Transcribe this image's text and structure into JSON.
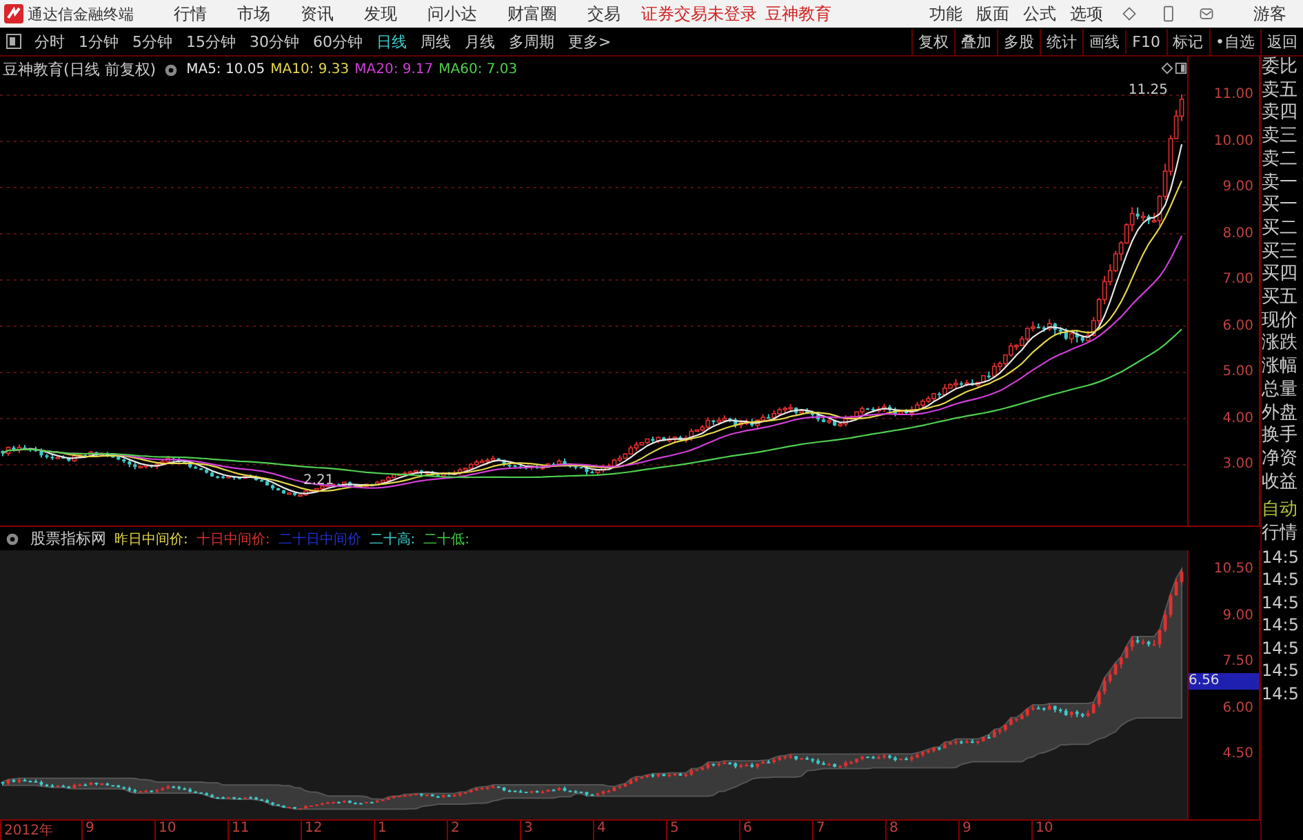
{
  "menu_bar": {
    "app_title": "通达信金融终端",
    "items": [
      "行情",
      "市场",
      "资讯",
      "发现",
      "问小达",
      "财富圈",
      "交易"
    ],
    "notices": [
      "证券交易未登录",
      "豆神教育"
    ],
    "right_items": [
      "功能",
      "版面",
      "公式",
      "选项"
    ],
    "user": "游客"
  },
  "toolbar": {
    "periods": [
      {
        "label": "分时",
        "selected": false
      },
      {
        "label": "1分钟",
        "selected": false
      },
      {
        "label": "5分钟",
        "selected": false
      },
      {
        "label": "15分钟",
        "selected": false
      },
      {
        "label": "30分钟",
        "selected": false
      },
      {
        "label": "60分钟",
        "selected": false
      },
      {
        "label": "日线",
        "selected": true
      },
      {
        "label": "周线",
        "selected": false
      },
      {
        "label": "月线",
        "selected": false
      },
      {
        "label": "多周期",
        "selected": false
      },
      {
        "label": "更多>",
        "selected": false
      }
    ],
    "actions": [
      "复权",
      "叠加",
      "多股",
      "统计",
      "画线",
      "F10",
      "标记",
      "•自选",
      "返回"
    ]
  },
  "price_chart": {
    "title": "豆神教育(日线 前复权)",
    "moving_averages": [
      {
        "label": "MA5: 10.05",
        "color": "#e8e8e8"
      },
      {
        "label": "MA10: 9.33",
        "color": "#e6d84a"
      },
      {
        "label": "MA20: 9.17",
        "color": "#d040d8"
      },
      {
        "label": "MA60: 7.03",
        "color": "#50d050"
      }
    ],
    "high_label": "11.25",
    "low_label": "2.21",
    "axis_labels": [
      "11.00",
      "10.00",
      "9.00",
      "8.00",
      "7.00",
      "6.00",
      "5.00",
      "4.00",
      "3.00"
    ]
  },
  "indicator_chart": {
    "name": "股票指标网",
    "lines": [
      {
        "label": "昨日中间价:",
        "color": "#e6d84a"
      },
      {
        "label": "十日中间价:",
        "color": "#e03030"
      },
      {
        "label": "二十日中间价",
        "color": "#2030d0"
      },
      {
        "label": "二十高:",
        "color": "#40d0d0"
      },
      {
        "label": "二十低:",
        "color": "#40d040"
      }
    ],
    "axis_labels": [
      "10.50",
      "9.00",
      "7.50",
      "6.00",
      "4.50"
    ],
    "current_value": "6.56"
  },
  "date_axis": [
    "2012年",
    "9",
    "10",
    "11",
    "12",
    "1",
    "2",
    "3",
    "4",
    "5",
    "6",
    "7",
    "8",
    "9",
    "10"
  ],
  "quote_panel": {
    "labels": [
      "委比",
      "卖五",
      "卖四",
      "卖三",
      "卖二",
      "卖一",
      "买一",
      "买二",
      "买三",
      "买四",
      "买五",
      "现价",
      "涨跌",
      "涨幅",
      "总量",
      "外盘",
      "换手",
      "净资",
      "收益"
    ],
    "mode": [
      "自动",
      "行情"
    ],
    "times": [
      "14:5",
      "14:5",
      "14:5",
      "14:5",
      "14:5",
      "14:5",
      "14:5"
    ]
  }
}
